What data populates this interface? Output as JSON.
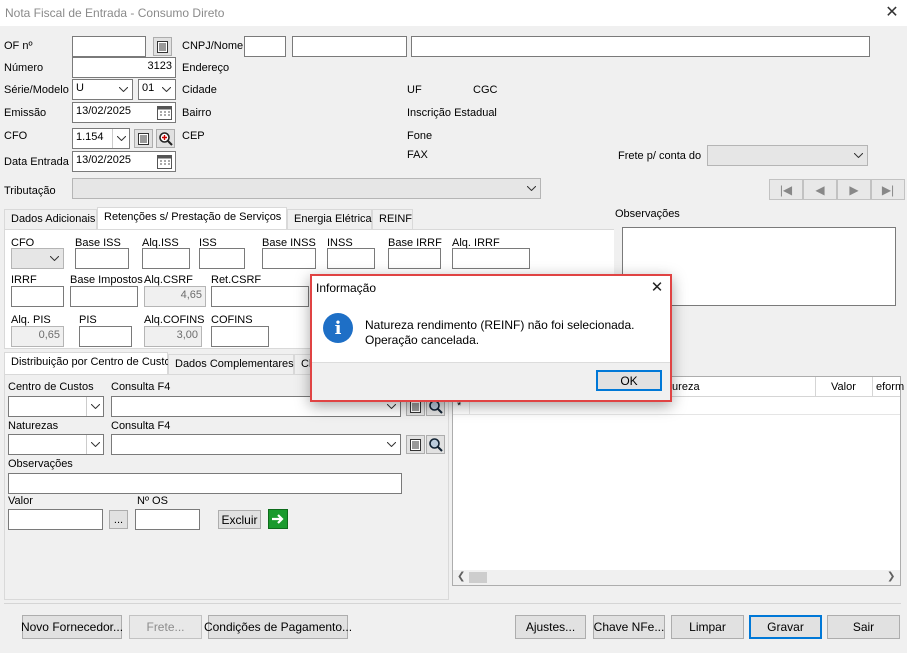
{
  "window": {
    "title": "Nota Fiscal de Entrada - Consumo Direto"
  },
  "header": {
    "of_label": "OF nº",
    "cnpj_label": "CNPJ/Nome",
    "numero_label": "Número",
    "numero_value": "3123",
    "endereco_label": "Endereço",
    "serie_label": "Série/Modelo",
    "serie_value": "U",
    "modelo_value": "01",
    "cidade_label": "Cidade",
    "uf_label": "UF",
    "cgc_label": "CGC",
    "emissao_label": "Emissão",
    "emissao_value": "13/02/2025",
    "bairro_label": "Bairro",
    "ie_label": "Inscrição Estadual",
    "cfo_label": "CFO",
    "cfo_value": "1.154",
    "cep_label": "CEP",
    "fone_label": "Fone",
    "fax_label": "FAX",
    "data_entrada_label": "Data Entrada",
    "data_entrada_value": "13/02/2025",
    "frete_label": "Frete p/ conta do",
    "tributacao_label": "Tributação",
    "observacoes_label": "Observações"
  },
  "tabs_top": [
    "Dados Adicionais",
    "Retenções s/ Prestação de Serviços",
    "Energia Elétrica",
    "REINF"
  ],
  "retencoes": {
    "cfo": "CFO",
    "base_iss": "Base ISS",
    "alq_iss": "Alq.ISS",
    "iss": "ISS",
    "base_inss": "Base INSS",
    "inss": "INSS",
    "base_irrf": "Base IRRF",
    "alq_irrf": "Alq. IRRF",
    "irrf": "IRRF",
    "base_impostos": "Base Impostos",
    "alq_csrf": "Alq.CSRF",
    "alq_csrf_value": "4,65",
    "ret_csrf": "Ret.CSRF",
    "alq_pis": "Alq. PIS",
    "alq_pis_value": "0,65",
    "pis": "PIS",
    "alq_cofins": "Alq.COFINS",
    "alq_cofins_value": "3,00",
    "cofins": "COFINS"
  },
  "tabs_bottom": [
    "Distribuição por Centro de Custo",
    "Dados Complementares",
    "Cl"
  ],
  "distribuicao": {
    "centro_label": "Centro de Custos",
    "consulta_label": "Consulta F4",
    "naturezas_label": "Naturezas",
    "consulta2_label": "Consulta F4",
    "obs_label": "Observações",
    "valor_label": "Valor",
    "os_label": "Nº OS",
    "browse_label": "...",
    "excluir_label": "Excluir"
  },
  "grid": {
    "col_natureza": "tureza",
    "col_valor": "Valor",
    "col_eform": "eform",
    "new_row_marker": "*"
  },
  "dialog": {
    "title": "Informação",
    "message_line1": "Natureza rendimento (REINF) não foi selecionada.",
    "message_line2": "Operação cancelada.",
    "ok_label": "OK"
  },
  "footer": {
    "novo_fornecedor": "Novo Fornecedor...",
    "frete": "Frete...",
    "condicoes": "Condições de Pagamento...",
    "ajustes": "Ajustes...",
    "chave_nfe": "Chave NFe...",
    "limpar": "Limpar",
    "gravar": "Gravar",
    "sair": "Sair"
  },
  "colors": {
    "accent": "#0078d7",
    "dialog_border": "#e04343",
    "info_icon": "#1e6fc6",
    "excluir_arrow": "#1a9a2e"
  }
}
